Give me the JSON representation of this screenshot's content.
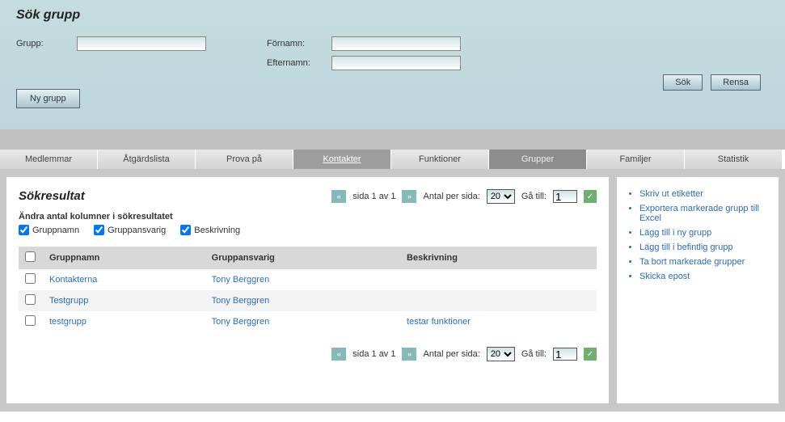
{
  "search_panel": {
    "title": "Sök grupp",
    "group_label": "Grupp:",
    "firstname_label": "Förnamn:",
    "lastname_label": "Efternamn:",
    "new_group_btn": "Ny grupp",
    "search_btn": "Sök",
    "clear_btn": "Rensa"
  },
  "tabs": [
    {
      "label": "Medlemmar"
    },
    {
      "label": "Åtgärdslista"
    },
    {
      "label": "Prova på"
    },
    {
      "label": "Kontakter",
      "active": true
    },
    {
      "label": "Funktioner"
    },
    {
      "label": "Grupper",
      "current": true
    },
    {
      "label": "Familjer"
    },
    {
      "label": "Statistik"
    }
  ],
  "results": {
    "title": "Sökresultat",
    "columns_caption": "Ändra antal kolumner i sökresultatet",
    "col_groupname": "Gruppnamn",
    "col_responsible": "Gruppansvarig",
    "col_description": "Beskrivning",
    "pager": {
      "page_text": "sida 1 av 1",
      "per_page_label": "Antal per sida:",
      "per_page_value": "20",
      "goto_label": "Gå till:",
      "goto_value": "1"
    },
    "headers": {
      "groupname": "Gruppnamn",
      "responsible": "Gruppansvarig",
      "description": "Beskrivning"
    },
    "rows": [
      {
        "name": "Kontakterna",
        "responsible": "Tony Berggren",
        "description": ""
      },
      {
        "name": "Testgrupp",
        "responsible": "Tony Berggren",
        "description": ""
      },
      {
        "name": "testgrupp",
        "responsible": "Tony Berggren",
        "description": "testar funktioner"
      }
    ]
  },
  "sidebar_links": [
    "Skriv ut etiketter",
    "Exportera markerade grupp till Excel",
    "Lägg till i ny grupp",
    "Lägg till i befintlig grupp",
    "Ta bort markerade grupper",
    "Skicka epost"
  ]
}
